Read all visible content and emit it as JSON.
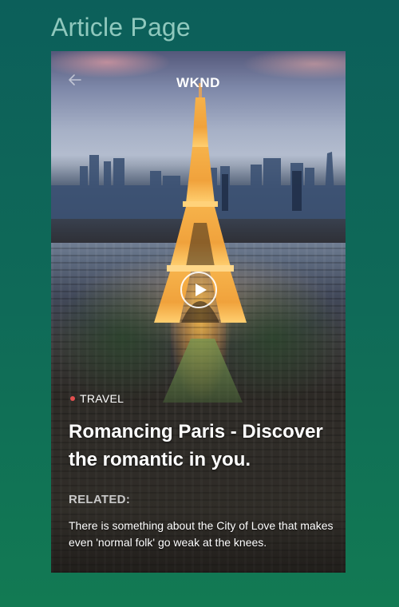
{
  "page_label": "Article Page",
  "header": {
    "back_icon": "arrow-left-icon",
    "brand": "WKND"
  },
  "hero": {
    "image_subject": "eiffel-tower-paris-dusk",
    "play_icon": "play-icon"
  },
  "article": {
    "category": "TRAVEL",
    "category_dot_color": "#e44f4f",
    "title": "Romancing Paris - Discover the romantic in you.",
    "related_label": "RELATED:",
    "description": "There is something about the City of Love that makes even 'normal folk' go weak at the knees."
  }
}
